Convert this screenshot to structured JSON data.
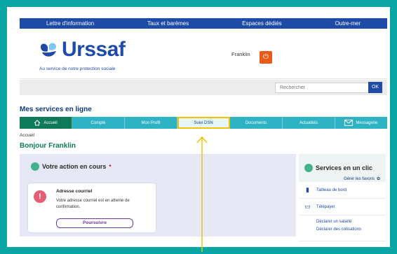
{
  "header": {
    "nav": [
      "Lettre d'information",
      "Taux et barèmes",
      "Espaces dédiés",
      "Outre-mer"
    ],
    "logo_text": "Urssaf",
    "tagline": "Au service de notre protection sociale",
    "user_name": "Franklin",
    "search_placeholder": "Rechercher",
    "search_button": "OK"
  },
  "main": {
    "section_title": "Mes services en ligne",
    "tabs": [
      {
        "label": "Accueil",
        "state": "active"
      },
      {
        "label": "Compte",
        "state": ""
      },
      {
        "label": "Mon Profil",
        "state": ""
      },
      {
        "label": "Suivi DSN",
        "state": "highlight"
      },
      {
        "label": "Documents",
        "state": ""
      },
      {
        "label": "Actualités",
        "state": ""
      },
      {
        "label": "Messagerie",
        "state": ""
      }
    ],
    "breadcrumb": "Accueil",
    "greeting": "Bonjour Franklin"
  },
  "action_panel": {
    "title": "Votre action en cours",
    "required_mark": "*",
    "card_title": "Adresse courriel",
    "card_message": "Votre adresse courriel est en attente de confirmation.",
    "continue_button": "Poursuivre"
  },
  "services_panel": {
    "title": "Services en un clic",
    "manage_favorites": "Gérer les favoris",
    "items": [
      "Tableau de bord",
      "Télépayer",
      "Déclarer un salarié",
      "Déclarer des cotisations"
    ]
  },
  "colors": {
    "outer_bg": "#0aa6a6",
    "brand_blue": "#1e4aa8",
    "tab_bar": "#2db3c4",
    "tab_active": "#0e7a5a",
    "highlight": "#f2c200",
    "power": "#ea5b1b"
  }
}
